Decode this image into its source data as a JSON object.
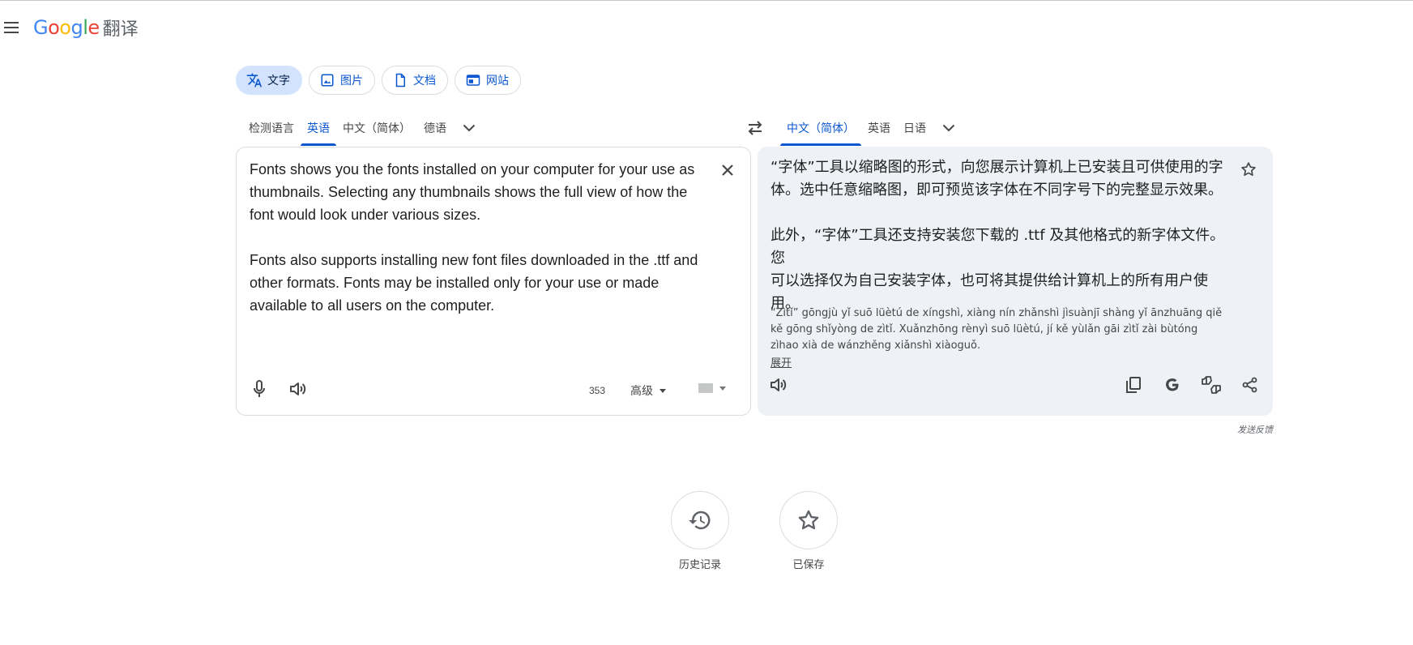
{
  "header": {
    "logo_google_letters": [
      "G",
      "o",
      "o",
      "g",
      "l",
      "e"
    ],
    "logo_colors": [
      "#4285F4",
      "#EA4335",
      "#FBBC05",
      "#4285F4",
      "#34A853",
      "#EA4335"
    ],
    "product_name": "翻译",
    "menu_icon": "hamburger-menu-icon"
  },
  "modes": [
    {
      "label": "文字",
      "icon": "translate-icon",
      "active": true
    },
    {
      "label": "图片",
      "icon": "image-icon",
      "active": false
    },
    {
      "label": "文档",
      "icon": "document-icon",
      "active": false
    },
    {
      "label": "网站",
      "icon": "website-icon",
      "active": false
    }
  ],
  "source_languages": {
    "tabs": [
      "检测语言",
      "英语",
      "中文（简体）",
      "德语"
    ],
    "selected": "英语"
  },
  "target_languages": {
    "tabs": [
      "中文（简体）",
      "英语",
      "日语"
    ],
    "selected": "中文（简体）"
  },
  "source": {
    "text": "Fonts shows you the fonts installed on your computer for your use as\nthumbnails. Selecting any thumbnails shows the full view of how the\nfont would look under various sizes.\n\nFonts also supports installing new font files downloaded in the .ttf and\nother formats. Fonts may be installed only for your use or made\navailable to all users on the computer.",
    "char_count": "353",
    "advanced_label": "高级"
  },
  "target": {
    "text": "“字体”工具以缩略图的形式，向您展示计算机上已安装且可供使用的字\n体。选中任意缩略图，即可预览该字体在不同字号下的完整显示效果。\n\n此外，“字体”工具还支持安装您下载的 .ttf 及其他格式的新字体文件。您\n可以选择仅为自己安装字体，也可将其提供给计算机上的所有用户使\n用。",
    "pinyin": "“Zìtǐ” gōngjù yǐ suō lüètú de xíngshì, xiàng nín zhǎnshì jìsuànjī shàng yǐ ānzhuāng qiě kě gōng shǐyòng de zìtǐ. Xuǎnzhōng rènyì suō lüètú, jí kě yùlǎn gāi zìtǐ zài bùtóng zìhao xià de wánzhěng xiǎnshì xiàoguǒ.",
    "expand_label": "展开"
  },
  "feedback_label": "发送反馈",
  "bottom_buttons": [
    {
      "label": "历史记录",
      "icon": "history-icon"
    },
    {
      "label": "已保存",
      "icon": "star-icon"
    }
  ],
  "colors": {
    "accent": "#0b57d0",
    "chip_active_bg": "#d3e3fd",
    "target_panel_bg": "#eef1f6",
    "border": "#dadce0"
  }
}
